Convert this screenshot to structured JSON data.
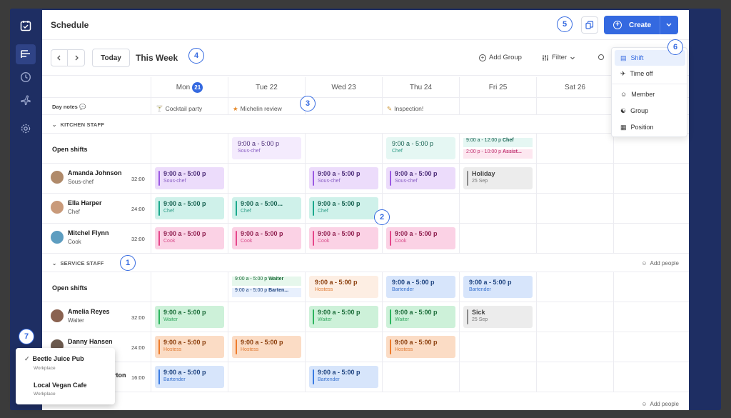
{
  "header": {
    "title": "Schedule",
    "create_label": "Create"
  },
  "toolbar": {
    "today_label": "Today",
    "range_label": "This Week",
    "add_group_label": "Add Group",
    "filter_label": "Filter"
  },
  "days": [
    {
      "label": "Mon",
      "num": "21"
    },
    {
      "label": "Tue 22"
    },
    {
      "label": "Wed 23"
    },
    {
      "label": "Thu 24"
    },
    {
      "label": "Fri 25"
    },
    {
      "label": "Sat 26"
    }
  ],
  "day_notes": {
    "label": "Day notes",
    "notes": [
      "Cocktail party",
      "Michelin review",
      "",
      "Inspection!",
      "",
      ""
    ]
  },
  "sections": {
    "kitchen": "KITCHEN STAFF",
    "service": "SERVICE STAFF",
    "add_people": "Add people"
  },
  "open_shifts_label": "Open shifts",
  "kitchen_open": {
    "tue": {
      "time": "9:00 a - 5:00 p",
      "role": "Sous-chef"
    },
    "thu": {
      "time": "9:00 a - 5:00 p",
      "role": "Chef"
    },
    "fri1": {
      "time": "9:00 a - 12:00 p",
      "role": "Chef"
    },
    "fri2": {
      "time": "2:00 p - 10:00 p",
      "role": "Assist..."
    }
  },
  "people": {
    "amanda": {
      "name": "Amanda Johnson",
      "role": "Sous-chef",
      "hours": "32:00"
    },
    "ella": {
      "name": "Ella Harper",
      "role": "Chef",
      "hours": "24:00"
    },
    "mitchel": {
      "name": "Mitchel Flynn",
      "role": "Cook",
      "hours": "32:00"
    },
    "amelia": {
      "name": "Amelia Reyes",
      "role": "Waiter",
      "hours": "32:00"
    },
    "danny": {
      "name": "Danny Hansen",
      "role": "",
      "hours": "24:00"
    },
    "third": {
      "name": "rton",
      "hours": "16:00"
    }
  },
  "shift": {
    "time": "9:00 a - 5:00 p",
    "time_short": "9:00 a - 5:00...",
    "sous_chef": "Sous-chef",
    "chef": "Chef",
    "cook": "Cook",
    "waiter": "Waiter",
    "hostess": "Hostess",
    "bartender": "Bartender"
  },
  "holiday": {
    "title": "Holiday",
    "date": "25 Sep"
  },
  "sick": {
    "title": "Sick",
    "date": "25 Sep"
  },
  "service_open": {
    "tue1": {
      "time": "9:00 a - 5:00 p",
      "role": "Waiter"
    },
    "tue2": {
      "time": "9:00 a - 5:00 p",
      "role": "Barten..."
    }
  },
  "create_menu": {
    "shift": "Shift",
    "time_off": "Time off",
    "member": "Member",
    "group": "Group",
    "position": "Position"
  },
  "workplaces": [
    {
      "name": "Beetle Juice Pub",
      "sub": "Workplace"
    },
    {
      "name": "Local Vegan Cafe",
      "sub": "Workplace"
    }
  ],
  "callouts": [
    "1",
    "2",
    "3",
    "4",
    "5",
    "6",
    "7"
  ],
  "colors": {
    "accent": "#3469e0",
    "rail": "#1e2e63"
  }
}
